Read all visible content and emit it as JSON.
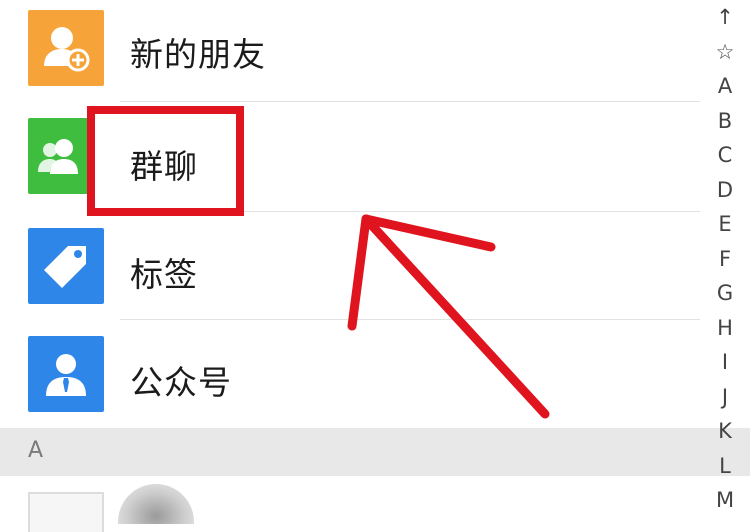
{
  "menu": [
    {
      "label": "新的朋友",
      "icon": "add-friend-icon",
      "color": "#f6a33a"
    },
    {
      "label": "群聊",
      "icon": "group-chat-icon",
      "color": "#3ebd3e"
    },
    {
      "label": "标签",
      "icon": "tag-icon",
      "color": "#2e87e8"
    },
    {
      "label": "公众号",
      "icon": "official-account-icon",
      "color": "#2e87e8"
    }
  ],
  "section": {
    "letter": "A"
  },
  "index": [
    "↑",
    "☆",
    "A",
    "B",
    "C",
    "D",
    "E",
    "F",
    "G",
    "H",
    "I",
    "J",
    "K",
    "L",
    "M"
  ],
  "annotation": {
    "color": "#e0141e",
    "highlighted_item": "群聊"
  }
}
